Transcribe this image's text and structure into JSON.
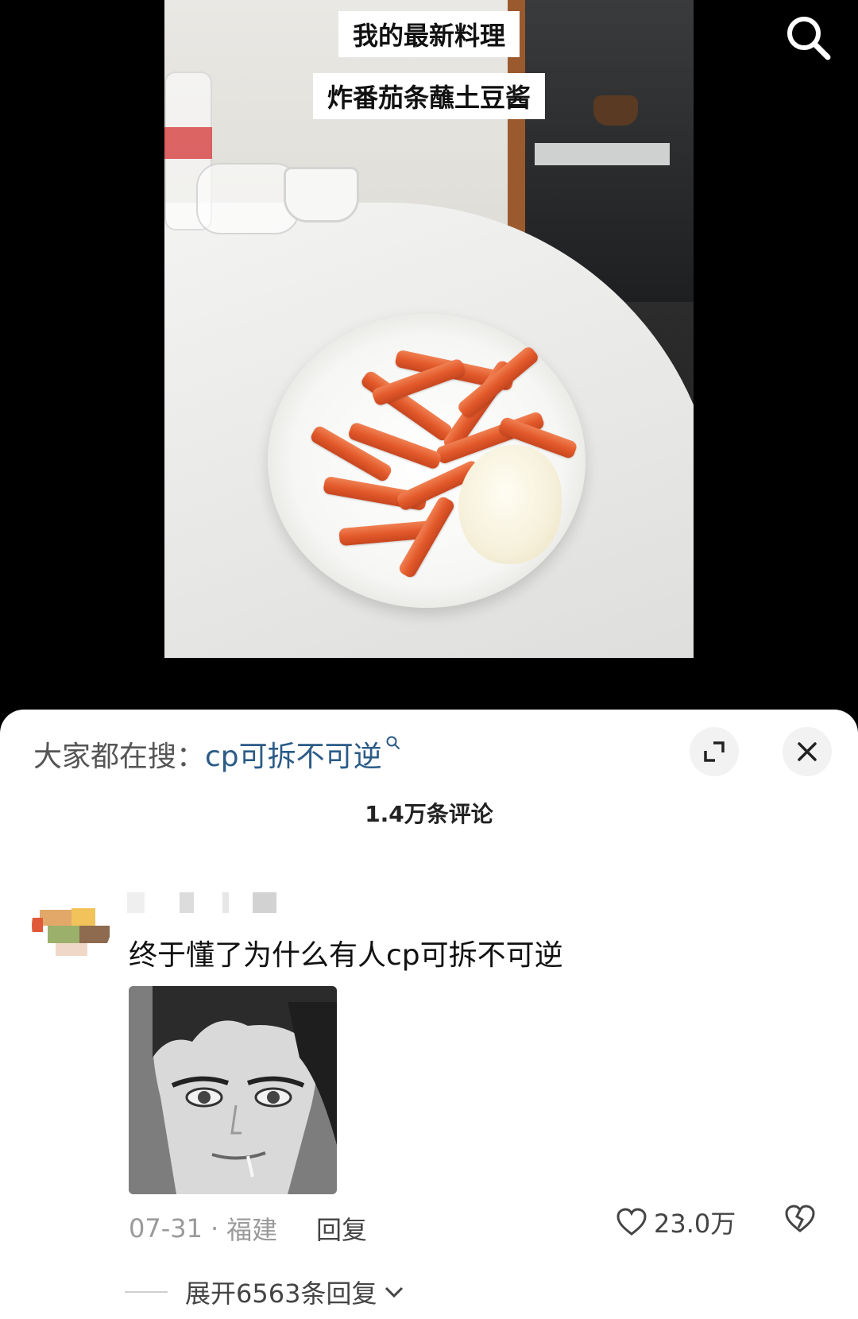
{
  "post": {
    "caption_line1": "我的最新料理",
    "caption_line2": "炸番茄条蘸土豆酱"
  },
  "toolbar": {
    "search_icon": "search-icon"
  },
  "comments_panel": {
    "suggest_label": "大家都在搜：",
    "suggest_term": "cp可拆不可逆",
    "expand_icon": "expand-icon",
    "close_icon": "close-icon",
    "comment_count": "1.4万条评论"
  },
  "comment": {
    "text": "终于懂了为什么有人cp可拆不可逆",
    "date": "07-31",
    "separator": "·",
    "location": "福建",
    "reply_label": "回复",
    "likes": "23.0万",
    "expand_replies": "展开6563条回复"
  },
  "colors": {
    "accent_link": "#2b5b87",
    "sheet_bg": "#ffffff",
    "video_bg": "#000000"
  }
}
